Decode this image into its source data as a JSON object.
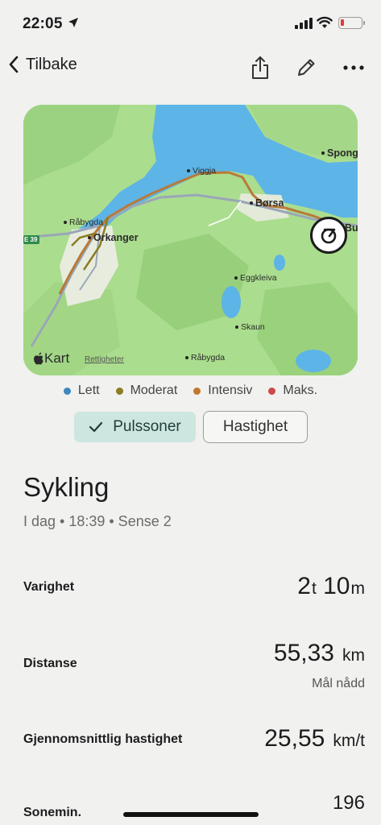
{
  "status": {
    "time": "22:05"
  },
  "nav": {
    "back_label": "Tilbake"
  },
  "map": {
    "places": {
      "viggja": "Viggja",
      "borsa": "Børsa",
      "spongdal": "Spong",
      "rabygda_top": "Råbygda",
      "orkanger": "Orkanger",
      "eggkleiva": "Eggkleiva",
      "skaun": "Skaun",
      "rabygda_bottom": "Råbygda",
      "edge_bu": "Bu"
    },
    "road_badge": "E 39",
    "attribution": "Kart",
    "legal_link": "Rettigheter"
  },
  "legend": [
    {
      "label": "Lett",
      "color": "#3f87bd"
    },
    {
      "label": "Moderat",
      "color": "#8a7d24"
    },
    {
      "label": "Intensiv",
      "color": "#c1782c"
    },
    {
      "label": "Maks.",
      "color": "#cc4a4a"
    }
  ],
  "toggles": {
    "pulse": "Pulssoner",
    "speed": "Hastighet"
  },
  "activity": {
    "title": "Sykling",
    "subtitle": "I dag • 18:39 • Sense 2"
  },
  "stats": {
    "duration": {
      "label": "Varighet",
      "hours": "2",
      "hours_unit": "t",
      "minutes": "10",
      "minutes_unit": "m"
    },
    "distance": {
      "label": "Distanse",
      "value": "55,33",
      "unit": "km",
      "note": "Mål nådd"
    },
    "avg_speed": {
      "label": "Gjennomsnittlig hastighet",
      "value": "25,55",
      "unit": "km/t"
    },
    "zone_minutes": {
      "label": "Sonemin.",
      "value": "196"
    }
  }
}
